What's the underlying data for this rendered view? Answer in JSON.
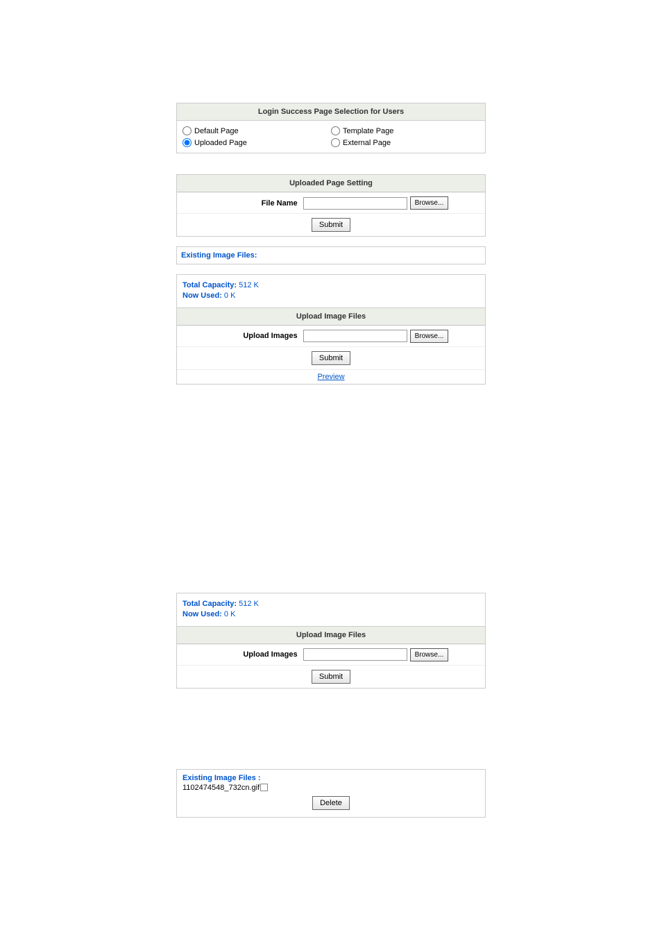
{
  "loginSuccess": {
    "header": "Login Success Page Selection for Users",
    "options": {
      "default": "Default Page",
      "template": "Template Page",
      "uploaded": "Uploaded Page",
      "external": "External Page"
    }
  },
  "uploadedPageSetting": {
    "header": "Uploaded Page Setting",
    "fileNameLabel": "File Name",
    "browse": "Browse...",
    "submit": "Submit"
  },
  "existingImageFilesHeader": "Existing Image Files:",
  "capacity": {
    "totalLabel": "Total Capacity:",
    "totalValue": " 512 K",
    "usedLabel": "Now Used:",
    "usedValue": " 0 K"
  },
  "uploadImageFiles": {
    "header": "Upload Image Files",
    "label": "Upload Images",
    "browse": "Browse...",
    "submit": "Submit",
    "preview": "Preview"
  },
  "uploadImageFiles2": {
    "header": "Upload Image Files",
    "label": "Upload Images",
    "browse": "Browse...",
    "submit": "Submit"
  },
  "existingFilesList": {
    "header": "Existing Image Files :",
    "file0": "1102474548_732cn.gif",
    "delete": "Delete"
  }
}
